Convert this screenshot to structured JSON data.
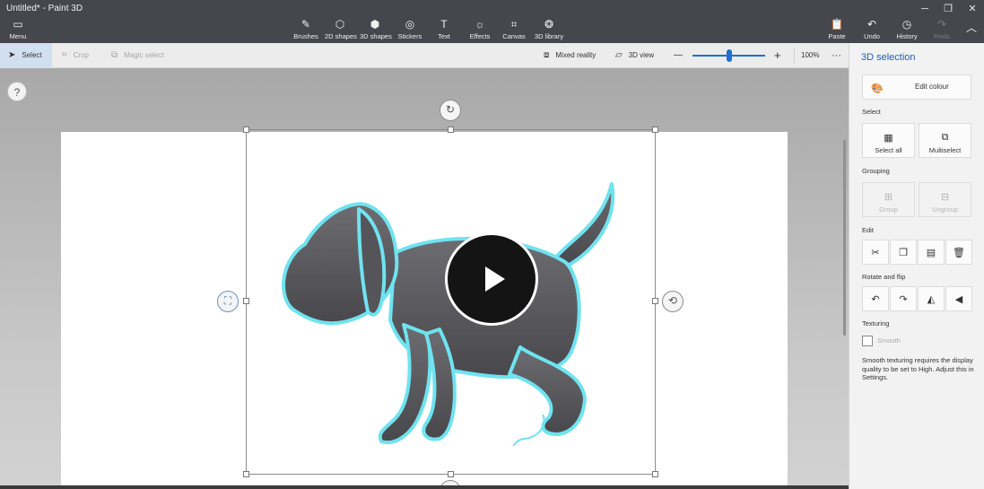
{
  "window": {
    "title": "Untitled* - Paint 3D",
    "minimize": "─",
    "restore": "❐",
    "close": "✕"
  },
  "menu": {
    "label": "Menu",
    "icon": "folder-icon"
  },
  "toolbar": {
    "tools": [
      {
        "label": "Brushes",
        "icon": "brush-icon"
      },
      {
        "label": "2D shapes",
        "icon": "2d-shapes-icon"
      },
      {
        "label": "3D shapes",
        "icon": "3d-shapes-icon"
      },
      {
        "label": "Stickers",
        "icon": "sticker-icon"
      },
      {
        "label": "Text",
        "icon": "text-icon"
      },
      {
        "label": "Effects",
        "icon": "effects-icon"
      },
      {
        "label": "Canvas",
        "icon": "canvas-icon"
      },
      {
        "label": "3D library",
        "icon": "3d-library-icon"
      }
    ],
    "paste": "Paste",
    "undo": "Undo",
    "history": "History",
    "redo": "Redo"
  },
  "commandbar": {
    "select": "Select",
    "crop": "Crop",
    "magic_select": "Magic select",
    "mixed_reality": "Mixed reality",
    "view_3d": "3D view",
    "zoom_out": "—",
    "zoom_in": "+",
    "zoom_value": "100%",
    "zoom_fraction": 0.5,
    "more": "···"
  },
  "workspace": {
    "help": "?"
  },
  "panel": {
    "title": "3D selection",
    "edit_colour": "Edit colour",
    "select_section": "Select",
    "select_all": "Select all",
    "multiselect": "Multiselect",
    "grouping_section": "Grouping",
    "group": "Group",
    "ungroup": "Ungroup",
    "edit_section": "Edit",
    "rotate_section": "Rotate and flip",
    "texturing_section": "Texturing",
    "smooth": "Smooth",
    "smooth_note": "Smooth texturing requires the display quality to be set to High. Adjust this in Settings."
  },
  "colors": {
    "titlebar": "#46464d",
    "accent": "#1e6fd0",
    "panel_title": "#1b5fb5",
    "selection_glow": "#6fe3f0",
    "dog": "#5a5a5e"
  }
}
